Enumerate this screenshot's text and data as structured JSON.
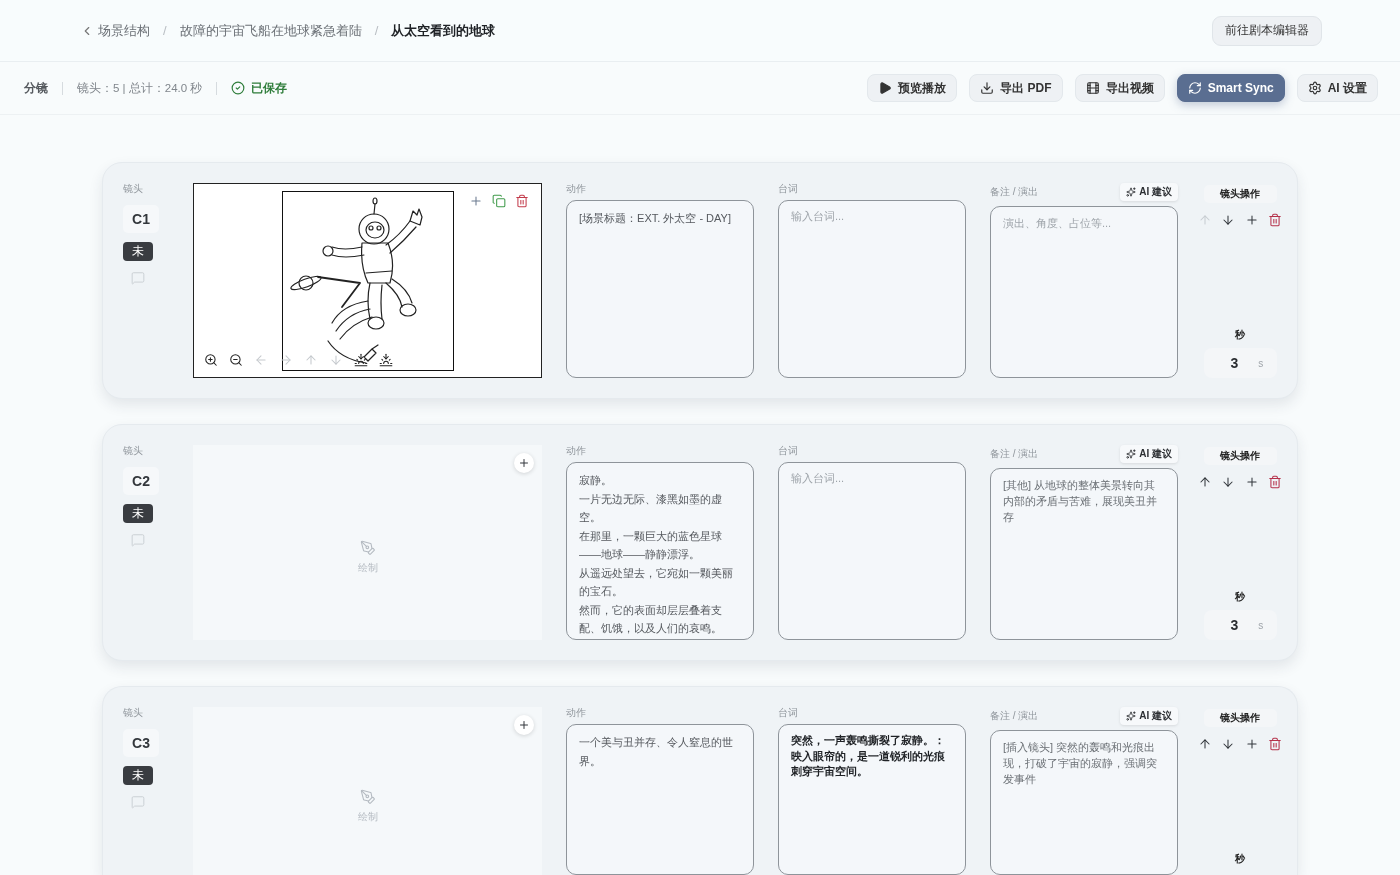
{
  "breadcrumb": {
    "separator": "/",
    "items": [
      {
        "label": "场景结构",
        "current": false
      },
      {
        "label": "故障的宇宙飞船在地球紧急着陆",
        "current": false
      },
      {
        "label": "从太空看到的地球",
        "current": true
      }
    ]
  },
  "editor_button": "前往剧本编辑器",
  "toolbar": {
    "title": "分镜",
    "summary": "镜头：5 | 总计：24.0 秒",
    "save_status": "已保存",
    "buttons": [
      {
        "kind": "preview",
        "label": "预览播放",
        "primary": false
      },
      {
        "kind": "pdf",
        "label": "导出 PDF",
        "primary": false
      },
      {
        "kind": "video",
        "label": "导出视频",
        "primary": false
      },
      {
        "kind": "sync",
        "label": "Smart Sync",
        "primary": true
      },
      {
        "kind": "settings",
        "label": "AI 设置",
        "primary": false
      }
    ]
  },
  "shots": [
    {
      "heading": "镜头",
      "id": "C1",
      "status": "未",
      "sketch": {
        "kind": "image",
        "actions": [
          {
            "kind": "add"
          },
          {
            "kind": "copy"
          },
          {
            "kind": "delete"
          }
        ],
        "tools": [
          {
            "kind": "zoom_in",
            "disabled": false
          },
          {
            "kind": "zoom_out",
            "disabled": false
          },
          {
            "kind": "left",
            "disabled": true
          },
          {
            "kind": "right",
            "disabled": true
          },
          {
            "kind": "up",
            "disabled": true
          },
          {
            "kind": "down",
            "disabled": true
          },
          {
            "kind": "drop",
            "disabled": false
          },
          {
            "kind": "drop",
            "disabled": false
          }
        ]
      },
      "fields": [
        {
          "kind": "action",
          "label": "动作",
          "value": "[场景标题：EXT. 外太空 - DAY]"
        },
        {
          "kind": "dialogue",
          "label": "台词",
          "placeholder": "输入台词..."
        },
        {
          "kind": "notes",
          "label": "备注 / 演出",
          "placeholder": "演出、角度、占位等...",
          "ai_button": "AI 建议"
        }
      ],
      "ops": {
        "title": "镜头操作",
        "buttons": [
          {
            "kind": "up",
            "disabled": true
          },
          {
            "kind": "down",
            "disabled": false
          },
          {
            "kind": "add",
            "disabled": false
          },
          {
            "kind": "delete",
            "disabled": false
          }
        ]
      },
      "duration_label": "秒",
      "duration": {
        "value": "3",
        "unit": "s"
      }
    },
    {
      "heading": "镜头",
      "id": "C2",
      "status": "未",
      "sketch": {
        "kind": "empty",
        "draw_label": "绘制",
        "actions": [
          {
            "kind": "add"
          }
        ]
      },
      "fields": [
        {
          "kind": "action",
          "label": "动作",
          "paragraphs": [
            "寂静。",
            "一片无边无际、漆黑如墨的虚空。",
            "在那里，一颗巨大的蓝色星球——地球——静静漂浮。",
            "从遥远处望去，它宛如一颗美丽的宝石。",
            "然而，它的表面却层层叠着支配、饥饿，以及人们的哀鸣。"
          ]
        },
        {
          "kind": "dialogue",
          "label": "台词",
          "placeholder": "输入台词..."
        },
        {
          "kind": "notes",
          "label": "备注 / 演出",
          "value": "[其他] 从地球的整体美景转向其内部的矛盾与苦难，展现美丑并存",
          "ai_button": "AI 建议"
        }
      ],
      "ops": {
        "title": "镜头操作",
        "buttons": [
          {
            "kind": "up",
            "disabled": false
          },
          {
            "kind": "down",
            "disabled": false
          },
          {
            "kind": "add",
            "disabled": false
          },
          {
            "kind": "delete",
            "disabled": false
          }
        ]
      },
      "duration_label": "秒",
      "duration": {
        "value": "3",
        "unit": "s"
      }
    },
    {
      "heading": "镜头",
      "id": "C3",
      "status": "未",
      "sketch": {
        "kind": "empty",
        "draw_label": "绘制",
        "actions": [
          {
            "kind": "add"
          }
        ]
      },
      "fields": [
        {
          "kind": "action",
          "label": "动作",
          "value": "一个美与丑并存、令人窒息的世界。"
        },
        {
          "kind": "dialogue",
          "label": "台词",
          "value": "突然，一声轰鸣撕裂了寂静。：映入眼帘的，是一道锐利的光痕刺穿宇宙空间。"
        },
        {
          "kind": "notes",
          "label": "备注 / 演出",
          "value": "[插入镜头] 突然的轰鸣和光痕出现，打破了宇宙的寂静，强调突发事件",
          "ai_button": "AI 建议"
        }
      ],
      "ops": {
        "title": "镜头操作",
        "buttons": [
          {
            "kind": "up",
            "disabled": false
          },
          {
            "kind": "down",
            "disabled": false
          },
          {
            "kind": "add",
            "disabled": false
          },
          {
            "kind": "delete",
            "disabled": false
          }
        ]
      },
      "duration_label": "秒"
    }
  ]
}
